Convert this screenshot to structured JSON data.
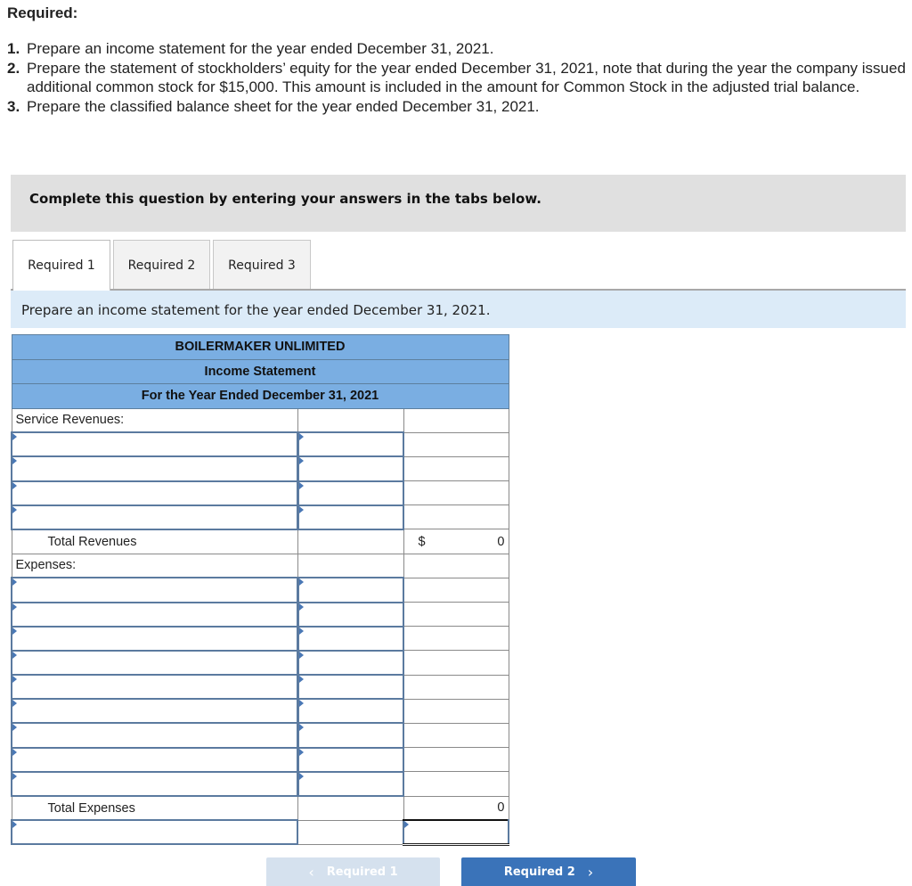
{
  "requirements": {
    "heading": "Required:",
    "items": [
      {
        "num": "1.",
        "text": "Prepare an income statement for the year ended December 31, 2021."
      },
      {
        "num": "2.",
        "text": "Prepare the statement of stockholders’ equity for the year ended December 31, 2021, note that during the year the company issued additional common stock for $15,000. This amount is included in the amount for Common Stock in the adjusted trial balance."
      },
      {
        "num": "3.",
        "text": "Prepare the classified balance sheet for the year ended December 31, 2021."
      }
    ]
  },
  "instruction": "Complete this question by entering your answers in the tabs below.",
  "tabs": [
    {
      "label": "Required 1",
      "active": true
    },
    {
      "label": "Required 2",
      "active": false
    },
    {
      "label": "Required 3",
      "active": false
    }
  ],
  "prompt": "Prepare an income statement for the year ended December 31, 2021.",
  "statement": {
    "company": "BOILERMAKER UNLIMITED",
    "title": "Income Statement",
    "period": "For the Year Ended December 31, 2021",
    "revenues_label": "Service Revenues:",
    "revenue_rows": [
      {
        "account": "",
        "amount": ""
      },
      {
        "account": "",
        "amount": ""
      },
      {
        "account": "",
        "amount": ""
      },
      {
        "account": "",
        "amount": ""
      }
    ],
    "total_revenues_label": "Total Revenues",
    "total_revenues_currency": "$",
    "total_revenues_value": "0",
    "expenses_label": "Expenses:",
    "expense_rows": [
      {
        "account": "",
        "amount": ""
      },
      {
        "account": "",
        "amount": ""
      },
      {
        "account": "",
        "amount": ""
      },
      {
        "account": "",
        "amount": ""
      },
      {
        "account": "",
        "amount": ""
      },
      {
        "account": "",
        "amount": ""
      },
      {
        "account": "",
        "amount": ""
      },
      {
        "account": "",
        "amount": ""
      },
      {
        "account": "",
        "amount": ""
      }
    ],
    "total_expenses_label": "Total Expenses",
    "total_expenses_value": "0",
    "net_income_label": "",
    "net_income_value": ""
  },
  "navigation": {
    "prev_label": "Required 1",
    "prev_icon": "‹",
    "next_label": "Required 2",
    "next_icon": "›",
    "prev_disabled": true
  },
  "colors": {
    "header_blue": "#7aaee2",
    "prompt_bg": "#dcebf8",
    "instruction_bg": "#e0e0e0",
    "next_button": "#3a73b9",
    "prev_button_disabled": "#d5e1ee",
    "input_border": "#5b7a9f"
  }
}
